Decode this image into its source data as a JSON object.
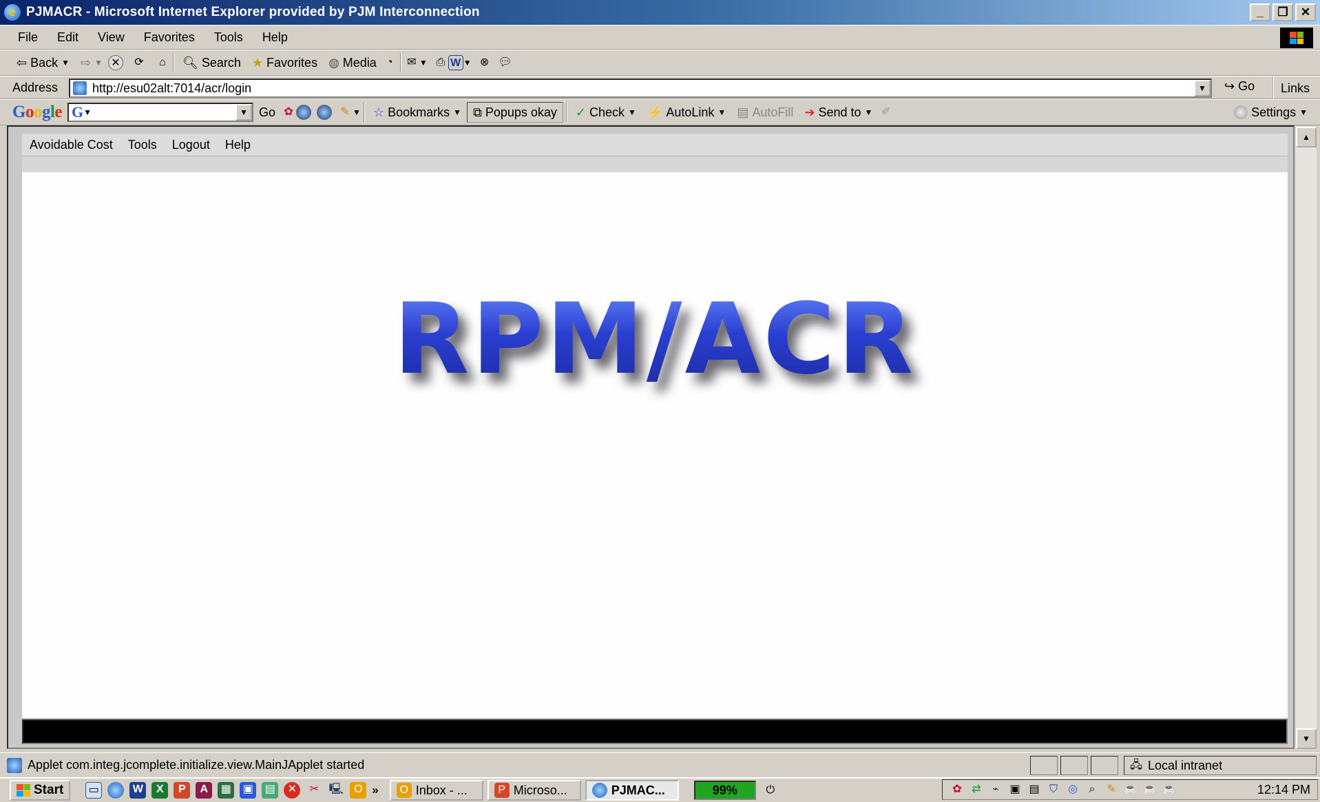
{
  "window": {
    "title": "PJMACR - Microsoft Internet Explorer provided by PJM Interconnection"
  },
  "menu": [
    "File",
    "Edit",
    "View",
    "Favorites",
    "Tools",
    "Help"
  ],
  "toolbar": {
    "back": "Back",
    "search": "Search",
    "favorites": "Favorites",
    "media": "Media"
  },
  "address": {
    "label": "Address",
    "url": "http://esu02alt:7014/acr/login",
    "go": "Go",
    "links": "Links"
  },
  "google": {
    "logo": "Google",
    "go": "Go",
    "bookmarks": "Bookmarks",
    "popups": "Popups okay",
    "check": "Check",
    "autolink": "AutoLink",
    "autofill": "AutoFill",
    "sendto": "Send to",
    "settings": "Settings"
  },
  "applet": {
    "menu": [
      "Avoidable Cost",
      "Tools",
      "Logout",
      "Help"
    ],
    "logo_text": "RPM/ACR"
  },
  "status": {
    "text": "Applet com.integ.jcomplete.initialize.view.MainJApplet started",
    "zone": "Local intranet"
  },
  "taskbar": {
    "start": "start",
    "tasks": [
      "Inbox - ...",
      "Microso...",
      "PJMAC..."
    ],
    "battery": "99%",
    "clock": "12:14 PM"
  },
  "colors": {
    "title_bar": "#0a246a",
    "logo_blue": "#2a3fd0",
    "chrome": "#d4d0c8"
  }
}
